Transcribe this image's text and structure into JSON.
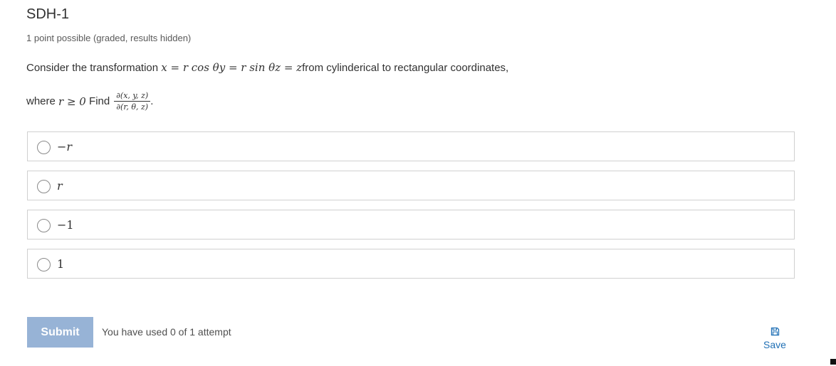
{
  "problem": {
    "title": "SDH-1",
    "points": "1 point possible (graded, results hidden)",
    "text_consider": "Consider the transformation",
    "math_transform": "x = r cos θy = r sin θz = z",
    "text_from": "from cylinderical to rectangular coordinates,",
    "text_where": "where",
    "math_condition": "r ≥ 0",
    "text_find": "Find",
    "frac_num": "∂(x, y, z)",
    "frac_den": "∂(r, θ, z)",
    "period": "."
  },
  "choices": [
    {
      "label": "−r"
    },
    {
      "label": "r"
    },
    {
      "label": "−1"
    },
    {
      "label": "1"
    }
  ],
  "actions": {
    "submit_label": "Submit",
    "attempts_text": "You have used 0 of 1 attempt",
    "save_label": "Save"
  }
}
